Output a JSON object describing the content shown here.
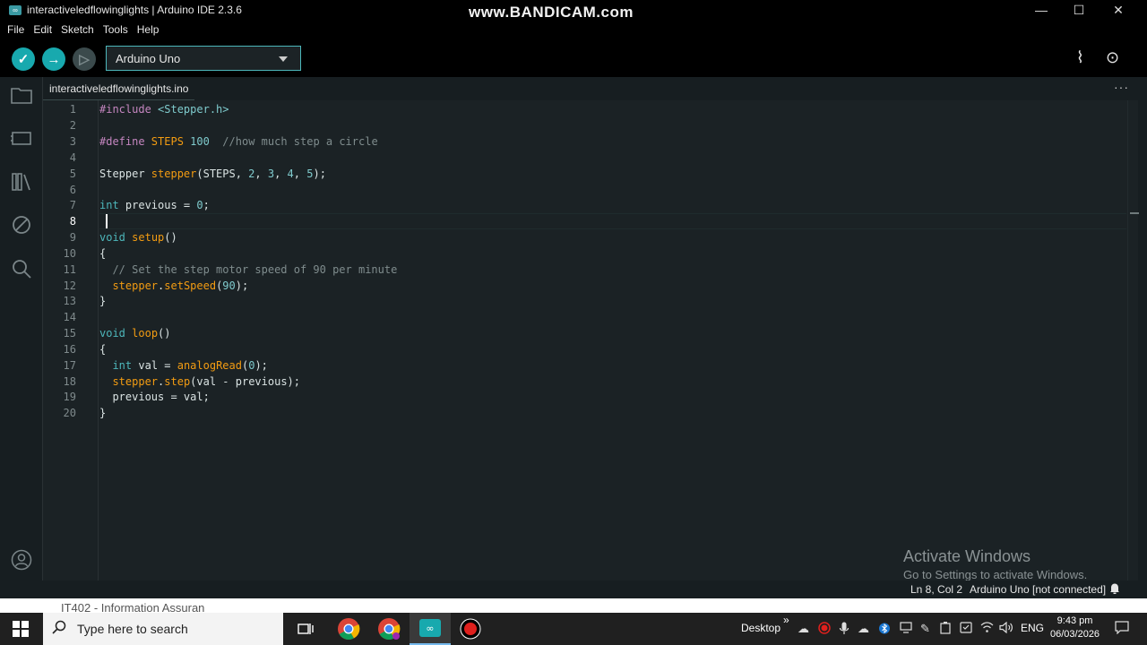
{
  "window": {
    "title": "interactiveledflowinglights | Arduino IDE 2.3.6",
    "watermark": "www.BANDICAM.com",
    "minimize": "—",
    "maximize": "☐",
    "close": "✕"
  },
  "menu": [
    "File",
    "Edit",
    "Sketch",
    "Tools",
    "Help"
  ],
  "toolbar": {
    "verify_icon": "✓",
    "upload_icon": "→",
    "debug_icon": "▷",
    "board": "Arduino Uno",
    "serial_plotter_icon": "⌇",
    "serial_monitor_icon": "⊙"
  },
  "tab": {
    "filename": "interactiveledflowinglights.ino",
    "more": "···"
  },
  "editor": {
    "active_line": 8,
    "lines": [
      {
        "n": "1"
      },
      {
        "n": "2"
      },
      {
        "n": "3"
      },
      {
        "n": "4"
      },
      {
        "n": "5"
      },
      {
        "n": "6"
      },
      {
        "n": "7"
      },
      {
        "n": "8"
      },
      {
        "n": "9"
      },
      {
        "n": "10"
      },
      {
        "n": "11"
      },
      {
        "n": "12"
      },
      {
        "n": "13"
      },
      {
        "n": "14"
      },
      {
        "n": "15"
      },
      {
        "n": "16"
      },
      {
        "n": "17"
      },
      {
        "n": "18"
      },
      {
        "n": "19"
      },
      {
        "n": "20"
      }
    ],
    "code": {
      "l1_a": "#include ",
      "l1_b": "<Stepper.h>",
      "l3_a": "#define ",
      "l3_b": "STEPS ",
      "l3_c": "100",
      "l3_d": "  //how much step a circle",
      "l5_a": "Stepper ",
      "l5_b": "stepper",
      "l5_c": "(STEPS, ",
      "l5_d": "2",
      "l5_e": ", ",
      "l5_f": "3",
      "l5_g": ", ",
      "l5_h": "4",
      "l5_i": ", ",
      "l5_j": "5",
      "l5_k": ");",
      "l7_a": "int",
      "l7_b": " previous = ",
      "l7_c": "0",
      "l7_d": ";",
      "l9_a": "void",
      "l9_b": " ",
      "l9_c": "setup",
      "l9_d": "()",
      "l10": "{",
      "l11": "  // Set the step motor speed of 90 per minute",
      "l12_a": "  ",
      "l12_b": "stepper",
      "l12_c": ".",
      "l12_d": "setSpeed",
      "l12_e": "(",
      "l12_f": "90",
      "l12_g": ");",
      "l13": "}",
      "l15_a": "void",
      "l15_b": " ",
      "l15_c": "loop",
      "l15_d": "()",
      "l16": "{",
      "l17_a": "  ",
      "l17_b": "int",
      "l17_c": " val = ",
      "l17_d": "analogRead",
      "l17_e": "(",
      "l17_f": "0",
      "l17_g": ");",
      "l18_a": "  ",
      "l18_b": "stepper",
      "l18_c": ".",
      "l18_d": "step",
      "l18_e": "(val - previous);",
      "l19": "  previous = val;",
      "l20": "}"
    }
  },
  "activation": {
    "title": "Activate Windows",
    "subtitle": "Go to Settings to activate Windows."
  },
  "status": {
    "position": "Ln 8, Col 2",
    "board": "Arduino Uno [not connected]",
    "bell": "🔔"
  },
  "under_window": {
    "text": "IT402 - Information Assuran"
  },
  "taskbar": {
    "search_placeholder": "Type here to search",
    "desktop_label": "Desktop",
    "chevron": "»",
    "language": "ENG",
    "time": "9:43 pm",
    "date": "06/03/2026"
  }
}
